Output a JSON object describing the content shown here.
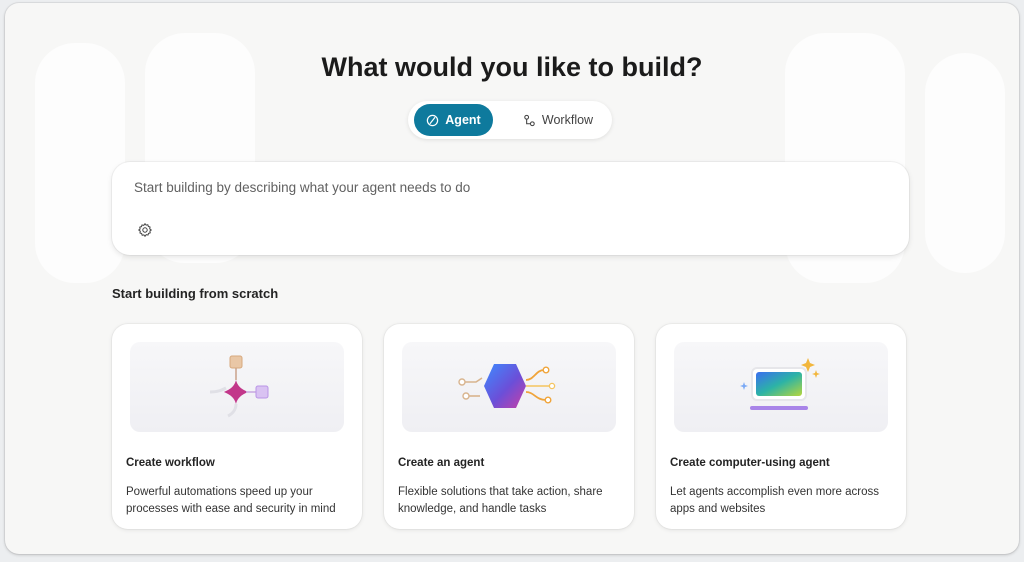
{
  "header": {
    "title": "What would you like to build?"
  },
  "mode_toggle": {
    "agent_label": "Agent",
    "workflow_label": "Workflow",
    "selected": "Agent",
    "accent_color": "#0e7a9d"
  },
  "prompt": {
    "placeholder": "Start building by describing what your agent needs to do",
    "value": "",
    "settings_icon": "gear-icon"
  },
  "scratch": {
    "section_title": "Start building from scratch",
    "cards": [
      {
        "title": "Create workflow",
        "description": "Powerful automations speed up your processes with ease and security in mind",
        "icon": "workflow-illustration"
      },
      {
        "title": "Create an agent",
        "description": "Flexible solutions that take action, share knowledge, and handle tasks",
        "icon": "agent-hexagon-illustration"
      },
      {
        "title": "Create computer-using agent",
        "description": "Let agents accomplish even more across apps and websites",
        "icon": "computer-screen-illustration"
      }
    ]
  }
}
